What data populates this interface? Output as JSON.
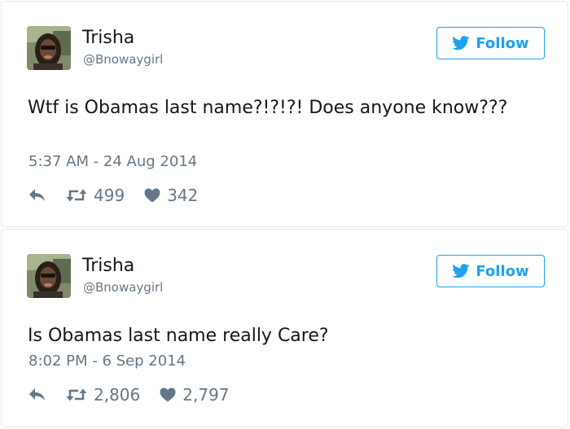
{
  "tweets": [
    {
      "name": "Trisha",
      "handle": "@Bnowaygirl",
      "follow_label": "Follow",
      "text": "Wtf is Obamas last name?!?!?! Does anyone know???",
      "timestamp": "5:37 AM - 24 Aug 2014",
      "retweets": "499",
      "likes": "342"
    },
    {
      "name": "Trisha",
      "handle": "@Bnowaygirl",
      "follow_label": "Follow",
      "text": "Is Obamas last name really Care?",
      "timestamp": "8:02 PM - 6 Sep 2014",
      "retweets": "2,806",
      "likes": "2,797"
    }
  ],
  "icons": {
    "reply": "reply-icon",
    "retweet": "retweet-icon",
    "like": "heart-icon",
    "follow": "twitter-bird-icon"
  },
  "colors": {
    "accent": "#1da1f2",
    "secondary_text": "#657786",
    "primary_text": "#14171a",
    "border": "#e1e8ed"
  }
}
